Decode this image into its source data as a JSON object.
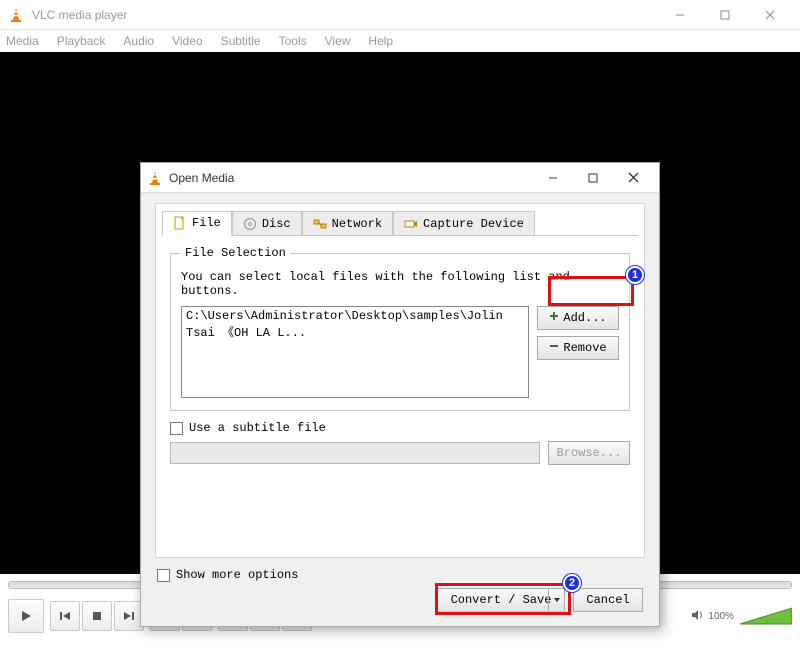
{
  "window": {
    "title": "VLC media player",
    "menus": [
      "Media",
      "Playback",
      "Audio",
      "Video",
      "Subtitle",
      "Tools",
      "View",
      "Help"
    ],
    "volume_pct": "100%"
  },
  "dialog": {
    "title": "Open Media",
    "tabs": {
      "file": "File",
      "disc": "Disc",
      "network": "Network",
      "capture": "Capture Device"
    },
    "file_selection_legend": "File Selection",
    "file_selection_hint": "You can select local files with the following list and buttons.",
    "file_listed": "C:\\Users\\Administrator\\Desktop\\samples\\Jolin Tsai 《OH LA L...",
    "add_label": "Add...",
    "remove_label": "Remove",
    "use_subtitle_label": "Use a subtitle file",
    "browse_label": "Browse...",
    "show_more_label": "Show more options",
    "convert_label": "Convert / Save",
    "cancel_label": "Cancel"
  },
  "annotations": {
    "badge1": "1",
    "badge2": "2"
  }
}
